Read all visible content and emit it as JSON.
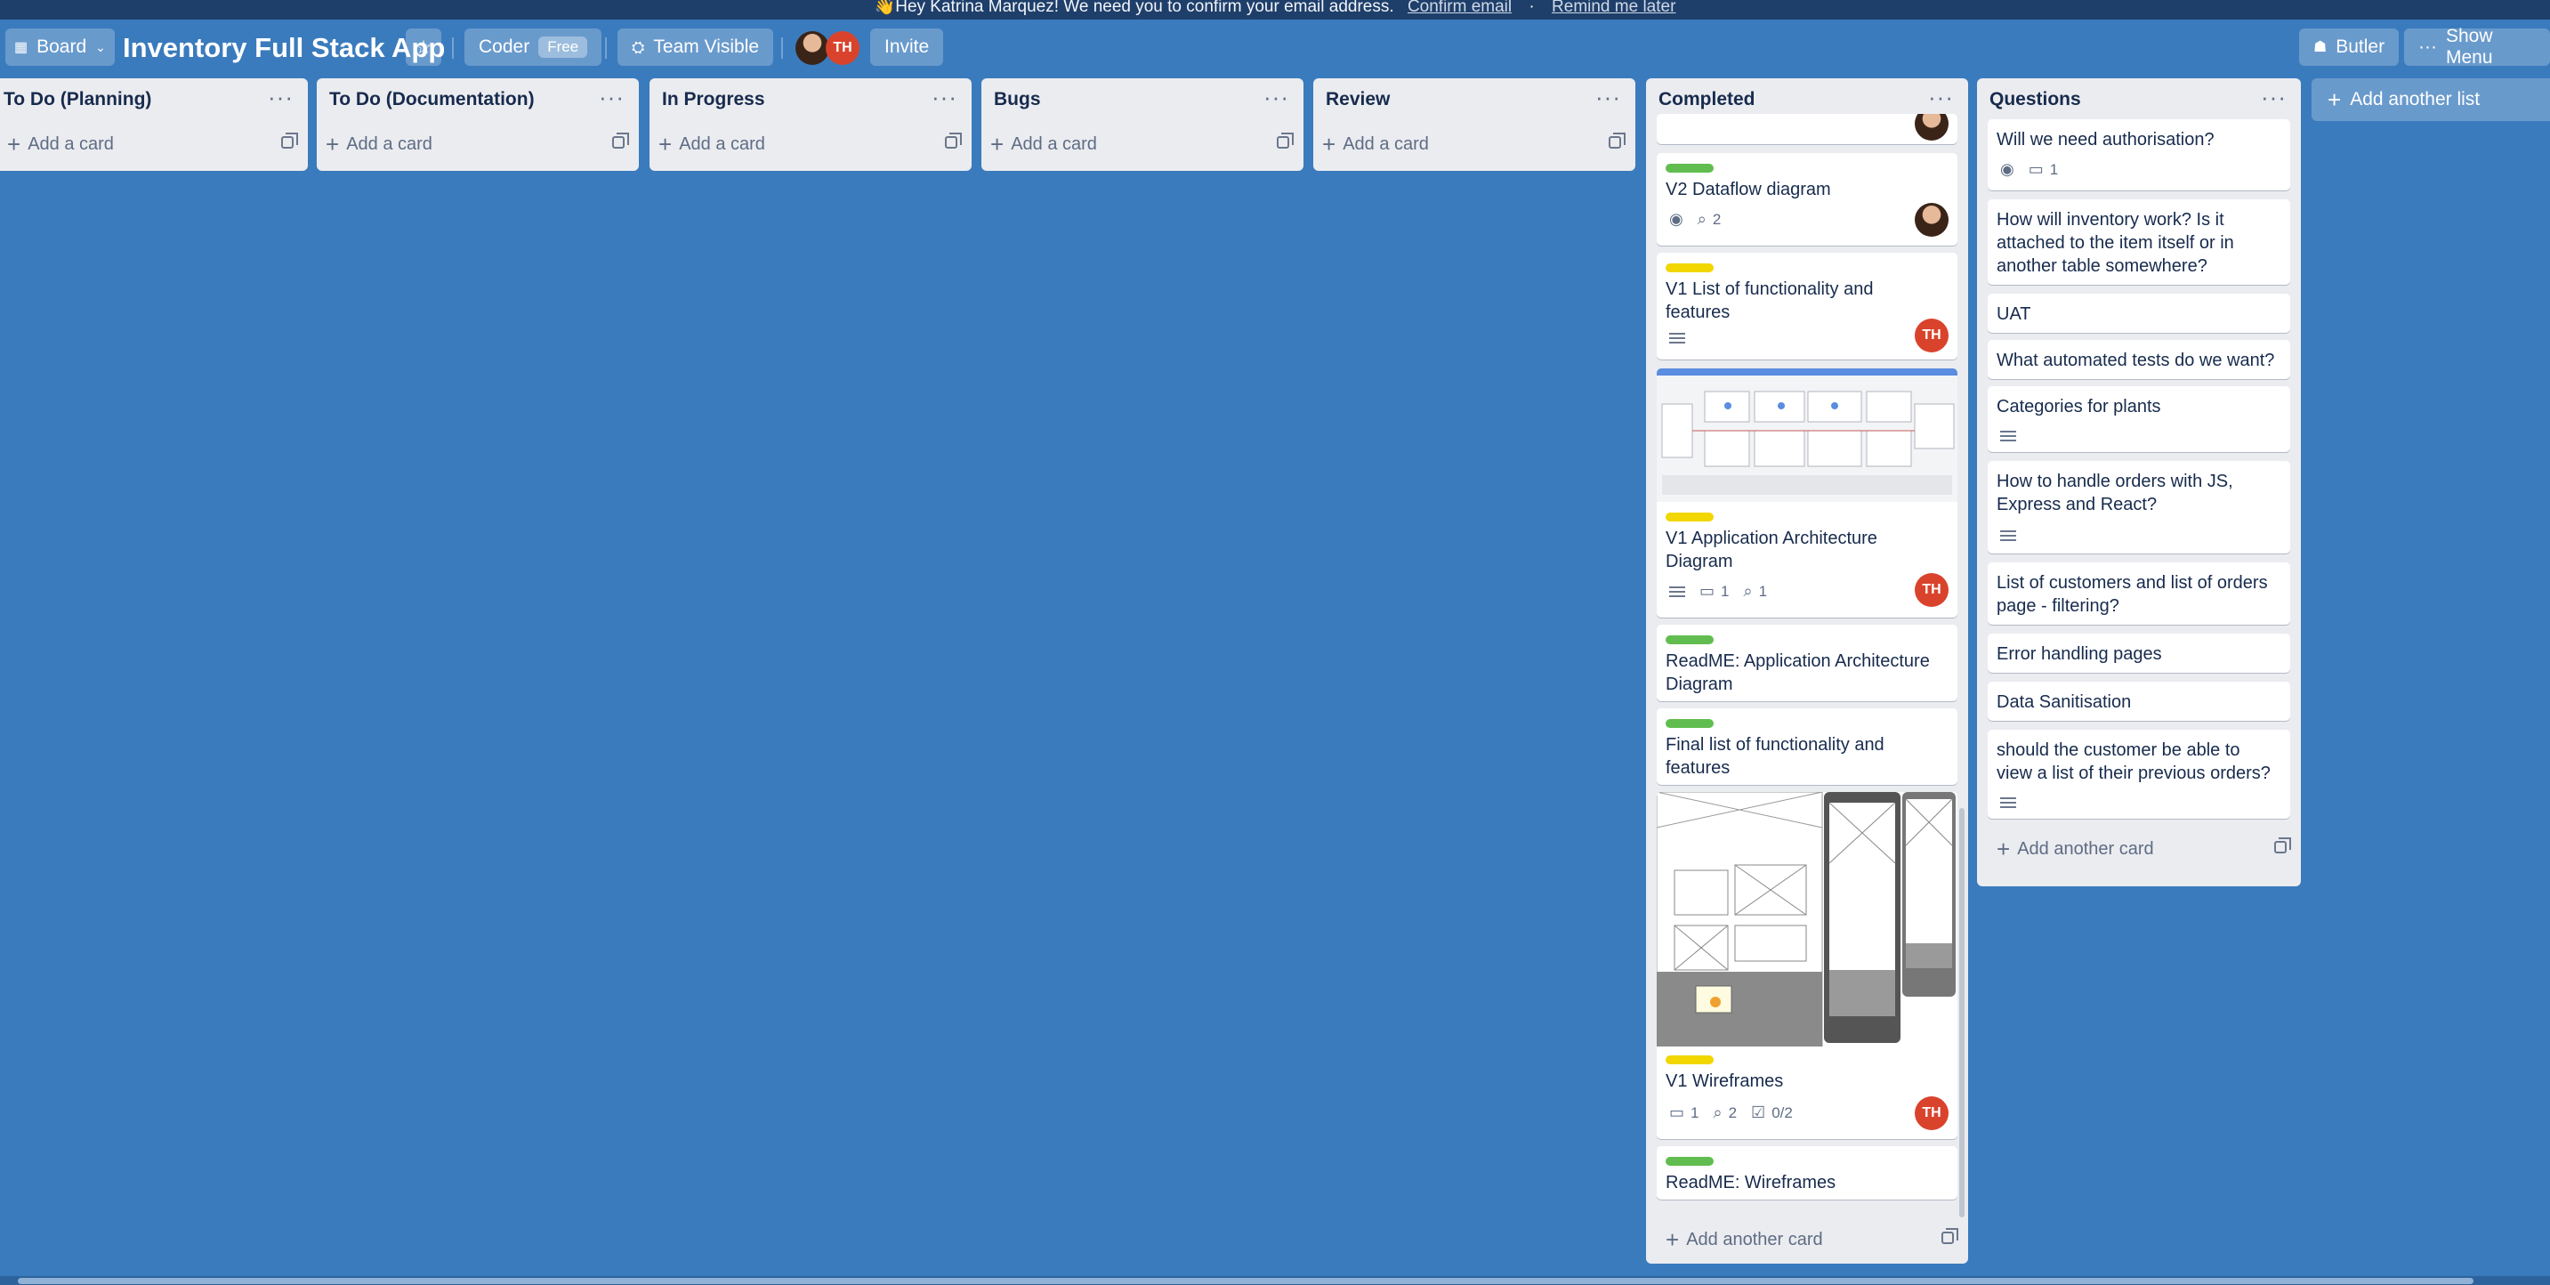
{
  "banner": {
    "text": "👋Hey Katrina Marquez! We need you to confirm your email address.",
    "confirm_link": "Confirm email",
    "separator": "·",
    "remind_link": "Remind me later"
  },
  "header": {
    "board_button": "Board",
    "board_title": "Inventory Full Stack App",
    "team_name": "Coder",
    "team_badge": "Free",
    "visibility": "Team Visible",
    "invite": "Invite",
    "member_initials": "TH",
    "butler": "Butler",
    "show_menu": "Show Menu"
  },
  "add_card_label": "Add a card",
  "add_another_card_label": "Add another card",
  "add_another_list": "Add another list",
  "lists": [
    {
      "title": "To Do (Planning)"
    },
    {
      "title": "To Do (Documentation)"
    },
    {
      "title": "In Progress"
    },
    {
      "title": "Bugs"
    },
    {
      "title": "Review"
    },
    {
      "title": "Completed",
      "cards": [
        {
          "title": "V2 Dataflow diagram",
          "label_color": "green",
          "attachments": "2",
          "member": "photo"
        },
        {
          "title": "V1 List of functionality and features",
          "label_color": "yellow",
          "member": "TH"
        },
        {
          "title": "V1 Application Architecture Diagram",
          "label_color": "yellow",
          "comments": "1",
          "attachments": "1",
          "member": "TH"
        },
        {
          "title": "ReadME: Application Architecture Diagram",
          "label_color": "green"
        },
        {
          "title": "Final list of functionality and features",
          "label_color": "green"
        },
        {
          "title": "V1 Wireframes",
          "label_color": "yellow",
          "comments": "1",
          "attachments": "2",
          "checklist": "0/2",
          "member": "TH"
        },
        {
          "title": "ReadME: Wireframes",
          "label_color": "green"
        }
      ]
    },
    {
      "title": "Questions",
      "cards": [
        {
          "title": "Will we need authorisation?",
          "comments": "1"
        },
        {
          "title": "How will inventory work? Is it attached to the item itself or in another table somewhere?"
        },
        {
          "title": "UAT"
        },
        {
          "title": "What automated tests do we want?"
        },
        {
          "title": "Categories for plants"
        },
        {
          "title": "How to handle orders with JS, Express and React?"
        },
        {
          "title": "List of customers and list of orders page - filtering?"
        },
        {
          "title": "Error handling pages"
        },
        {
          "title": "Data Sanitisation"
        },
        {
          "title": "should the customer be able to view a list of their previous orders?"
        }
      ]
    }
  ],
  "colors": {
    "board_background": "#3a7bbd",
    "label_green": "#61bd4f",
    "label_yellow": "#f2d600",
    "member_th": "#d9432c"
  }
}
